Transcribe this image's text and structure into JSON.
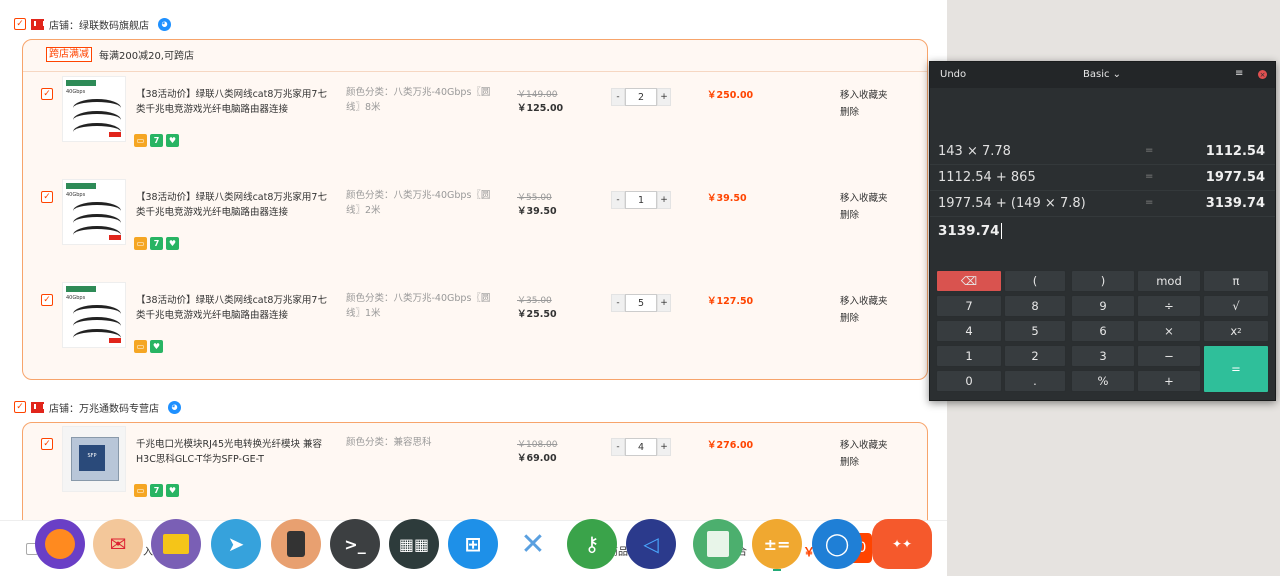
{
  "cart": {
    "shops": [
      {
        "name": "店铺：绿联数码旗舰店",
        "promo_tag": "跨店满减",
        "promo_text": "每满200减20,可跨店",
        "items": [
          {
            "title": "【38活动价】绿联八类网线cat8万兆家用7七类千兆电竞游戏光纤电脑路由器连接",
            "spec": "颜色分类：八类万兆-40Gbps〖圆线〗8米",
            "price_old": "￥149.00",
            "price_now": "￥125.00",
            "qty": "2",
            "subtotal": "￥250.00",
            "op_fav": "移入收藏夹",
            "op_del": "删除",
            "thumb_top": "八类万兆（圆线）",
            "thumb_sub": "40Gbps"
          },
          {
            "title": "【38活动价】绿联八类网线cat8万兆家用7七类千兆电竞游戏光纤电脑路由器连接",
            "spec": "颜色分类：八类万兆-40Gbps〖圆线〗2米",
            "price_old": "￥55.00",
            "price_now": "￥39.50",
            "qty": "1",
            "subtotal": "￥39.50",
            "op_fav": "移入收藏夹",
            "op_del": "删除",
            "thumb_top": "八类万兆（圆线）",
            "thumb_sub": "40Gbps"
          },
          {
            "title": "【38活动价】绿联八类网线cat8万兆家用7七类千兆电竞游戏光纤电脑路由器连接",
            "spec": "颜色分类：八类万兆-40Gbps〖圆线〗1米",
            "price_old": "￥35.00",
            "price_now": "￥25.50",
            "qty": "5",
            "subtotal": "￥127.50",
            "op_fav": "移入收藏夹",
            "op_del": "删除",
            "thumb_top": "八类万兆（圆线）",
            "thumb_sub": "40Gbps"
          }
        ]
      },
      {
        "name": "店铺：万兆通数码专营店",
        "items": [
          {
            "title": "千兆电口光模块RJ45光电转换光纤模块 兼容H3C思科GLC-T华为SFP-GE-T",
            "spec": "颜色分类：兼容思科",
            "price_old": "￥108.00",
            "price_now": "￥69.00",
            "qty": "4",
            "subtotal": "￥276.00",
            "op_fav": "移入收藏夹",
            "op_del": "删除",
            "thumb_top": "SFP",
            "thumb_sub": ""
          }
        ]
      }
    ],
    "qty_minus": "-",
    "qty_plus": "+",
    "badge_seven": "7",
    "bottom": {
      "select_all": "入",
      "selected": "商品",
      "total_label": "合",
      "total_prefix": "￥",
      "total_tail": "0"
    }
  },
  "calculator": {
    "undo": "Undo",
    "mode": "Basic ⌄",
    "menu": "≡",
    "close": "×",
    "history": [
      {
        "expr": "143 × 7.78",
        "eq": "=",
        "res": "1112.54"
      },
      {
        "expr": "1112.54 + 865",
        "eq": "=",
        "res": "1977.54"
      },
      {
        "expr": "1977.54 + (149 × 7.8)",
        "eq": "=",
        "res": "3139.74"
      }
    ],
    "current": "3139.74",
    "keys": {
      "del": "⌫",
      "lparen": "(",
      "rparen": ")",
      "mod": "mod",
      "pi": "π",
      "k7": "7",
      "k8": "8",
      "k9": "9",
      "div": "÷",
      "sqrt": "√",
      "k4": "4",
      "k5": "5",
      "k6": "6",
      "mul": "×",
      "sq": "x",
      "k1": "1",
      "k2": "2",
      "k3": "3",
      "sub": "−",
      "k0": "0",
      "dot": ".",
      "pct": "%",
      "add": "+",
      "eq": "="
    }
  },
  "dock": [
    "firefox-icon",
    "mail-icon",
    "files-icon",
    "telegram-icon",
    "music-icon",
    "terminal-icon",
    "workspaces-icon",
    "windows-icon",
    "x-icon",
    "keys-icon",
    "vscode-icon",
    "spreadsheet-icon",
    "calculator-icon",
    "messages-icon",
    "store-icon"
  ]
}
